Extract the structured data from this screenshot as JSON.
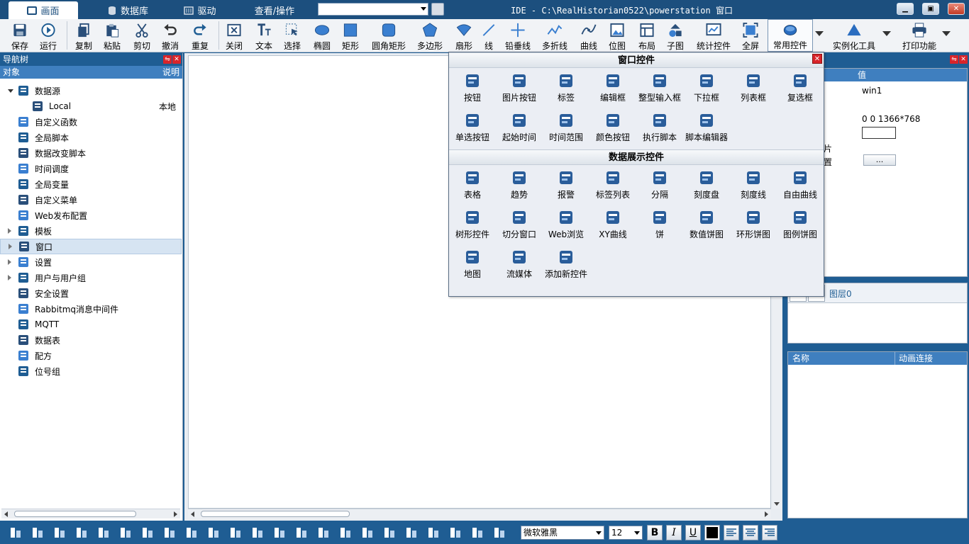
{
  "topbar": {
    "tabs": [
      {
        "label": "画面",
        "icon": "monitor-icon",
        "active": true
      },
      {
        "label": "数据库",
        "icon": "database-icon"
      },
      {
        "label": "驱动",
        "icon": "driver-icon"
      },
      {
        "label": "查看/操作",
        "icon": ""
      }
    ],
    "search_value": "",
    "window_title": "IDE - C:\\RealHistorian0522\\powerstation  窗口"
  },
  "toolbar": {
    "items": [
      {
        "label": "保存",
        "icon": "save-icon"
      },
      {
        "label": "运行",
        "icon": "run-icon"
      },
      {
        "label": "复制",
        "icon": "copy-icon"
      },
      {
        "label": "粘贴",
        "icon": "paste-icon"
      },
      {
        "label": "剪切",
        "icon": "cut-icon"
      },
      {
        "label": "撤消",
        "icon": "undo-icon"
      },
      {
        "label": "重复",
        "icon": "redo-icon"
      },
      {
        "label": "关闭",
        "icon": "close-window-icon"
      },
      {
        "label": "文本",
        "icon": "text-icon"
      },
      {
        "label": "选择",
        "icon": "select-icon"
      },
      {
        "label": "椭圆",
        "icon": "ellipse-icon"
      },
      {
        "label": "矩形",
        "icon": "rectangle-icon"
      },
      {
        "label": "圆角矩形",
        "icon": "rounded-rectangle-icon"
      },
      {
        "label": "多边形",
        "icon": "polygon-icon"
      },
      {
        "label": "扇形",
        "icon": "sector-icon"
      },
      {
        "label": "线",
        "icon": "line-icon"
      },
      {
        "label": "铅垂线",
        "icon": "plumb-line-icon"
      },
      {
        "label": "多折线",
        "icon": "polyline-icon"
      },
      {
        "label": "曲线",
        "icon": "curve-icon"
      },
      {
        "label": "位图",
        "icon": "bitmap-icon"
      },
      {
        "label": "布局",
        "icon": "layout-icon"
      },
      {
        "label": "子图",
        "icon": "subgraph-icon"
      },
      {
        "label": "统计控件",
        "icon": "stats-icon"
      },
      {
        "label": "全屏",
        "icon": "fullscreen-icon"
      },
      {
        "label": "常用控件",
        "icon": "common-controls-icon"
      },
      {
        "label": "实例化工具",
        "icon": "instance-tool-icon"
      },
      {
        "label": "打印功能",
        "icon": "print-icon"
      }
    ]
  },
  "nav": {
    "title": "导航树",
    "col_object": "对象",
    "col_desc": "说明",
    "nodes": [
      {
        "label": "数据源",
        "icon": "datasource-icon",
        "expander": "open"
      },
      {
        "label": "Local",
        "desc": "本地",
        "icon": "local-icon"
      },
      {
        "label": "自定义函数",
        "icon": "function-icon"
      },
      {
        "label": "全局脚本",
        "icon": "script-icon"
      },
      {
        "label": "数据改变脚本",
        "icon": "data-change-script-icon"
      },
      {
        "label": "时间调度",
        "icon": "clock-icon"
      },
      {
        "label": "全局变量",
        "icon": "variable-icon"
      },
      {
        "label": "自定义菜单",
        "icon": "menu-icon"
      },
      {
        "label": "Web发布配置",
        "icon": "web-publish-icon"
      },
      {
        "label": "模板",
        "icon": "template-icon",
        "expander": "closed"
      },
      {
        "label": "窗口",
        "icon": "window-icon",
        "expander": "closed",
        "selected": true
      },
      {
        "label": "设置",
        "icon": "gear-icon",
        "expander": "closed"
      },
      {
        "label": "用户与用户组",
        "icon": "users-icon",
        "expander": "closed"
      },
      {
        "label": "安全设置",
        "icon": "shield-icon"
      },
      {
        "label": "Rabbitmq消息中间件",
        "icon": "rabbitmq-icon"
      },
      {
        "label": "MQTT",
        "icon": "mqtt-icon"
      },
      {
        "label": "数据表",
        "icon": "datatable-icon"
      },
      {
        "label": "配方",
        "icon": "recipe-icon"
      },
      {
        "label": "位号组",
        "icon": "tag-group-icon"
      }
    ]
  },
  "props": {
    "col_value": "值",
    "rows": [
      {
        "label": "",
        "value": "win1"
      },
      {
        "label": "",
        "value": "0 0 1366*768"
      },
      {
        "label": "片",
        "value": ""
      },
      {
        "label": "置",
        "value": "..."
      }
    ],
    "layer_label": "图层0",
    "anim_col_name": "名称",
    "anim_col_link": "动画连接"
  },
  "popup": {
    "section1": "窗口控件",
    "section1_items": [
      {
        "label": "按钮",
        "icon": "button-icon"
      },
      {
        "label": "图片按钮",
        "icon": "image-button-icon"
      },
      {
        "label": "标签",
        "icon": "label-icon"
      },
      {
        "label": "编辑框",
        "icon": "editbox-icon"
      },
      {
        "label": "整型输入框",
        "icon": "int-input-icon"
      },
      {
        "label": "下拉框",
        "icon": "dropdown-icon"
      },
      {
        "label": "列表框",
        "icon": "listbox-icon"
      },
      {
        "label": "复选框",
        "icon": "checkbox-icon"
      },
      {
        "label": "单选按钮",
        "icon": "radio-icon"
      },
      {
        "label": "起始时间",
        "icon": "start-time-icon"
      },
      {
        "label": "时间范围",
        "icon": "time-range-icon"
      },
      {
        "label": "颜色按钮",
        "icon": "color-button-icon"
      },
      {
        "label": "执行脚本",
        "icon": "exec-script-icon"
      },
      {
        "label": "脚本编辑器",
        "icon": "script-editor-icon"
      }
    ],
    "section2": "数据展示控件",
    "section2_items": [
      {
        "label": "表格",
        "icon": "table-icon"
      },
      {
        "label": "趋势",
        "icon": "trend-icon"
      },
      {
        "label": "报警",
        "icon": "alarm-icon"
      },
      {
        "label": "标签列表",
        "icon": "tag-list-icon"
      },
      {
        "label": "分隔",
        "icon": "splitter-icon"
      },
      {
        "label": "刻度盘",
        "icon": "dial-icon"
      },
      {
        "label": "刻度线",
        "icon": "scale-line-icon"
      },
      {
        "label": "自由曲线",
        "icon": "free-curve-icon"
      },
      {
        "label": "树形控件",
        "icon": "tree-control-icon"
      },
      {
        "label": "切分窗口",
        "icon": "split-window-icon"
      },
      {
        "label": "Web浏览",
        "icon": "web-browser-icon"
      },
      {
        "label": "XY曲线",
        "icon": "xy-curve-icon"
      },
      {
        "label": "饼",
        "icon": "pie-icon"
      },
      {
        "label": "数值饼图",
        "icon": "value-pie-icon"
      },
      {
        "label": "环形饼图",
        "icon": "ring-pie-icon"
      },
      {
        "label": "图例饼图",
        "icon": "legend-pie-icon"
      },
      {
        "label": "地图",
        "icon": "map-icon"
      },
      {
        "label": "流媒体",
        "icon": "stream-media-icon"
      },
      {
        "label": "添加新控件",
        "icon": "add-control-icon"
      }
    ]
  },
  "bottombar": {
    "font_name": "微软雅黑",
    "font_size": "12",
    "bold": "B",
    "italic": "I",
    "underline": "U"
  }
}
